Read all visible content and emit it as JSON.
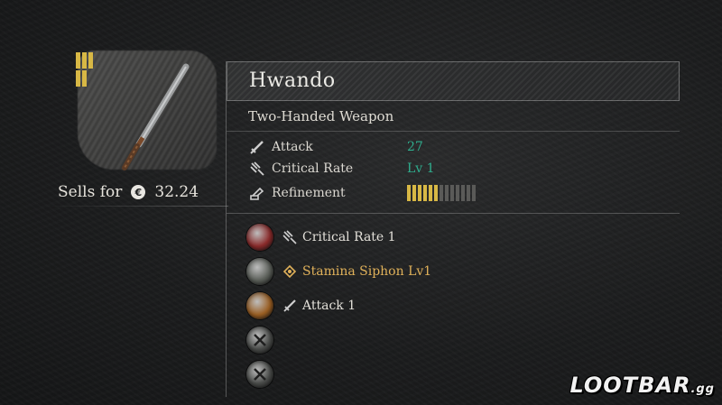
{
  "item": {
    "name": "Hwando",
    "type": "Two-Handed Weapon",
    "sell_label": "Sells for",
    "sell_value": "32.24",
    "tier_bars": 3
  },
  "stats": [
    {
      "label": "Attack",
      "value": "27",
      "icon": "sword-icon"
    },
    {
      "label": "Critical Rate",
      "value": "Lv 1",
      "icon": "critical-rate-icon"
    },
    {
      "label": "Refinement",
      "icon": "refinement-icon",
      "refinement_level": 6,
      "refinement_max": 13
    }
  ],
  "slots": [
    {
      "icon": "critical-rate-icon",
      "text": "Critical Rate 1",
      "orb_color": "#8a2a2a",
      "highlight": false
    },
    {
      "icon": "stamina-diamond-icon",
      "text": "Stamina Siphon Lv1",
      "orb_color": "#5a5e58",
      "highlight": true
    },
    {
      "icon": "sword-icon",
      "text": "Attack 1",
      "orb_color": "#9a5e22",
      "highlight": false
    },
    {
      "icon": "empty-slot-icon",
      "text": "",
      "orb_color": "#4a4c4a",
      "highlight": false
    },
    {
      "icon": "empty-slot-icon",
      "text": "",
      "orb_color": "#4a4c4a",
      "highlight": false
    }
  ],
  "colors": {
    "stat_value": "#2fae8e",
    "gold": "#e0b15a",
    "refine_on": "#d8b845",
    "refine_off": "#5a5a58"
  },
  "watermark": {
    "text": "LOOTBAR",
    "suffix": ".gg"
  }
}
